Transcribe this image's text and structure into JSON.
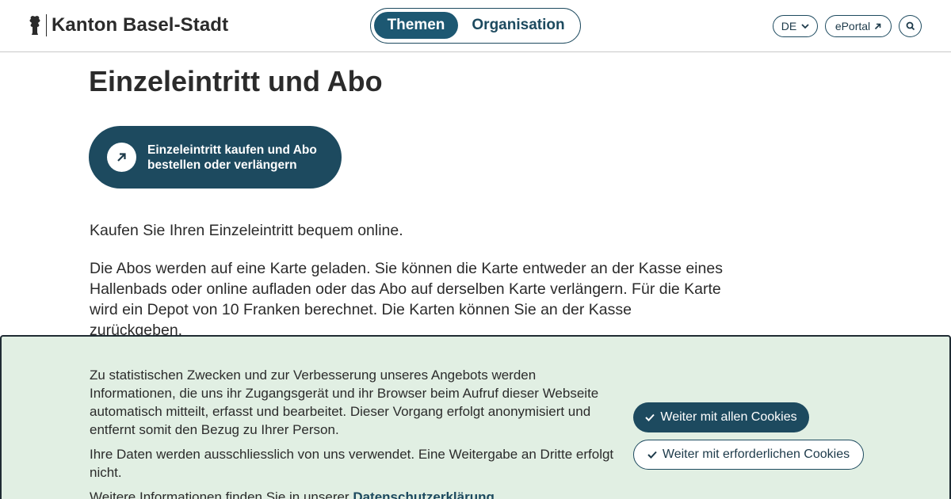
{
  "header": {
    "site_name": "Kanton Basel-Stadt",
    "nav": {
      "themen": "Themen",
      "organisation": "Organisation"
    },
    "language": "DE",
    "eportal": "ePortal"
  },
  "main": {
    "title": "Einzeleintritt und Abo",
    "cta_line1": "Einzeleintritt kaufen und Abo",
    "cta_line2": "bestellen oder verlängern",
    "para1": "Kaufen Sie Ihren Einzeleintritt bequem online.",
    "para2": "Die Abos werden auf eine Karte geladen. Sie können die Karte entweder an der Kasse eines Hallenbads oder online aufladen oder das Abo auf derselben Karte verlängern. Für die Karte wird ein Depot von 10 Franken berechnet. Die Karten können Sie an der Kasse zurückgeben."
  },
  "cookie": {
    "text1": "Zu statistischen Zwecken und zur Verbesserung unseres Angebots werden Informationen, die uns ihr Zugangsgerät und ihr Browser beim Aufruf dieser Webseite automatisch mitteilt, erfasst und bearbeitet. Dieser Vorgang erfolgt anonymisiert und entfernt somit den Bezug zu Ihrer Person.",
    "text2": "Ihre Daten werden ausschliesslich von uns verwendet. Eine Weitergabe an Dritte erfolgt nicht.",
    "text3_prefix": "Weitere Informationen finden Sie in unserer ",
    "privacy_link": "Datenschutzerklärung",
    "text3_suffix": ".",
    "accept_all": "Weiter mit allen Cookies",
    "accept_required": "Weiter mit erforderlichen Cookies"
  },
  "colors": {
    "primary": "#1d4a5f",
    "nav_active": "#1d5872",
    "cookie_bg": "#e1efe3"
  },
  "icons": [
    "basel-staff-logo-icon",
    "chevron-down-icon",
    "external-link-icon",
    "search-icon",
    "arrow-up-right-icon",
    "check-icon"
  ]
}
